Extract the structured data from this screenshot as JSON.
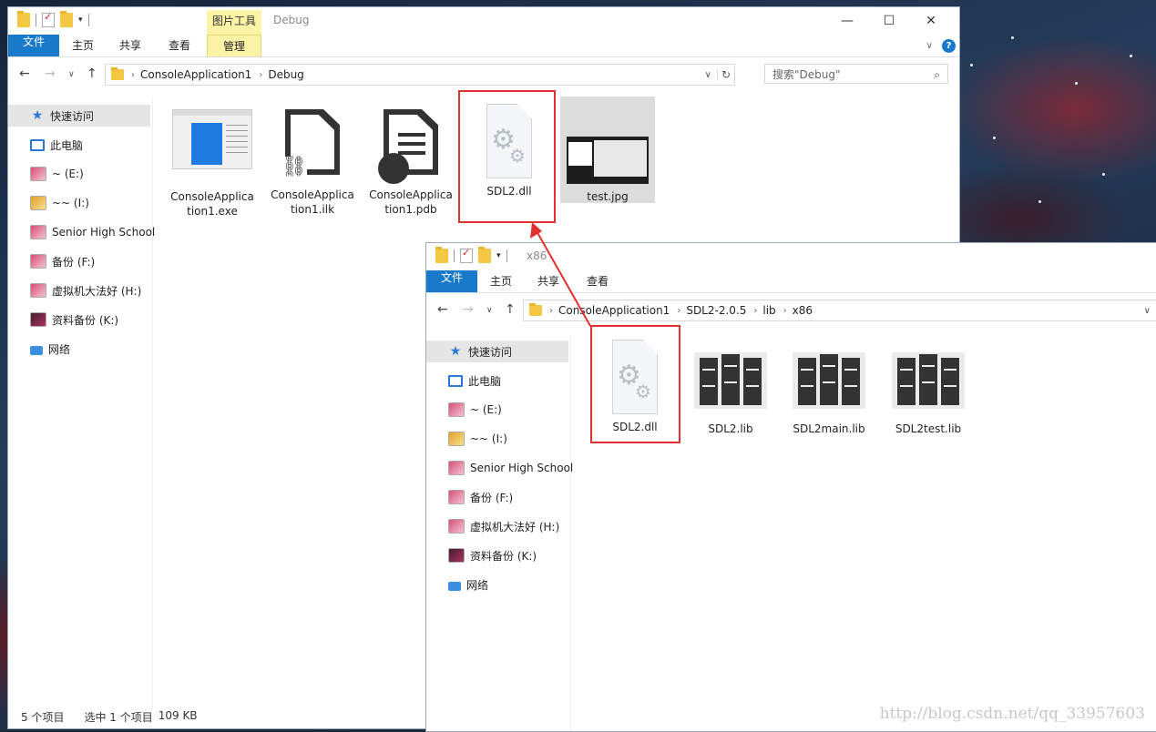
{
  "window1": {
    "title": "Debug",
    "contextual_tab": "图片工具",
    "tabs": [
      "文件",
      "主页",
      "共享",
      "查看",
      "管理"
    ],
    "breadcrumb": [
      "ConsoleApplication1",
      "Debug"
    ],
    "search_placeholder": "搜索\"Debug\"",
    "sidebar": [
      "快速访问",
      "此电脑",
      "~ (E:)",
      "~~ (I:)",
      "Senior High School",
      "备份 (F:)",
      "虚拟机大法好 (H:)",
      "资料备份 (K:)",
      "网络"
    ],
    "files": [
      {
        "name": "ConsoleApplication1.exe",
        "icon": "exe-icon"
      },
      {
        "name": "ConsoleApplication1.ilk",
        "icon": "link-file-icon"
      },
      {
        "name": "ConsoleApplication1.pdb",
        "icon": "pdb-file-icon"
      },
      {
        "name": "SDL2.dll",
        "icon": "dll-gear-icon"
      },
      {
        "name": "test.jpg",
        "icon": "image-thumbnail"
      }
    ],
    "status": {
      "count": "5 个项目",
      "selected": "选中 1 个项目",
      "size": "109 KB"
    }
  },
  "window2": {
    "title": "x86",
    "tabs": [
      "文件",
      "主页",
      "共享",
      "查看"
    ],
    "breadcrumb": [
      "ConsoleApplication1",
      "SDL2-2.0.5",
      "lib",
      "x86"
    ],
    "sidebar": [
      "快速访问",
      "此电脑",
      "~ (E:)",
      "~~ (I:)",
      "Senior High School",
      "备份 (F:)",
      "虚拟机大法好 (H:)",
      "资料备份 (K:)",
      "网络"
    ],
    "files": [
      {
        "name": "SDL2.dll",
        "icon": "dll-gear-icon"
      },
      {
        "name": "SDL2.lib",
        "icon": "library-icon"
      },
      {
        "name": "SDL2main.lib",
        "icon": "library-icon"
      },
      {
        "name": "SDL2test.lib",
        "icon": "library-icon"
      }
    ]
  },
  "watermark": "http://blog.csdn.net/qq_33957603",
  "colors": {
    "accent": "#1979ca",
    "highlight": "#e0302f",
    "contextual": "#fbf3a6"
  }
}
